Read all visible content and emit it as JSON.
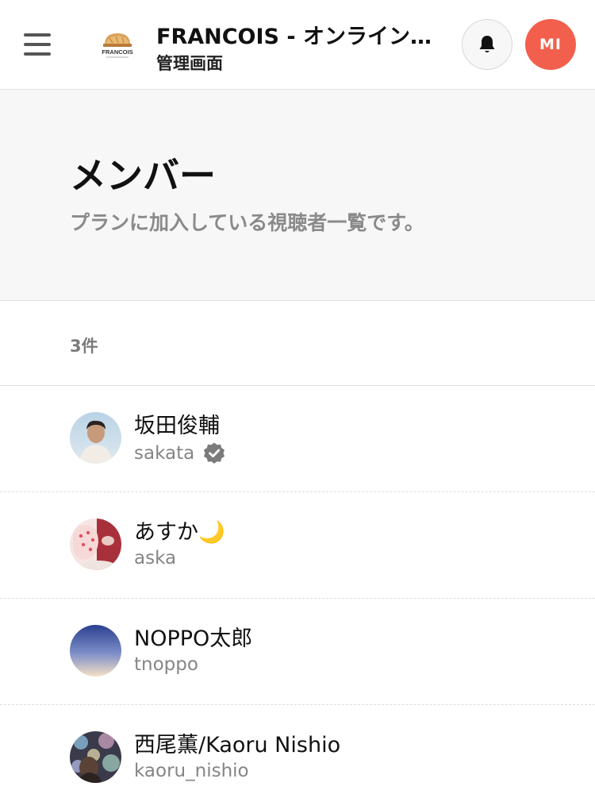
{
  "header": {
    "site_title": "FRANCOIS - オンライン...",
    "site_subtitle": "管理画面",
    "logo_text": "FRANCOIS",
    "user_initials": "MI"
  },
  "page": {
    "title": "メンバー",
    "description": "プランに加入している視聴者一覧です。",
    "count": "3件"
  },
  "members": [
    {
      "name": "坂田俊輔",
      "handle": "sakata",
      "verified": true
    },
    {
      "name": "あすか🌙",
      "handle": "aska",
      "verified": false
    },
    {
      "name": "NOPPO太郎",
      "handle": "tnoppo",
      "verified": false
    },
    {
      "name": "西尾薫/Kaoru Nishio",
      "handle": "kaoru_nishio",
      "verified": false
    }
  ],
  "colors": {
    "accent": "#f2604d",
    "hero_bg": "#f7f7f7",
    "muted_text": "#858585"
  }
}
